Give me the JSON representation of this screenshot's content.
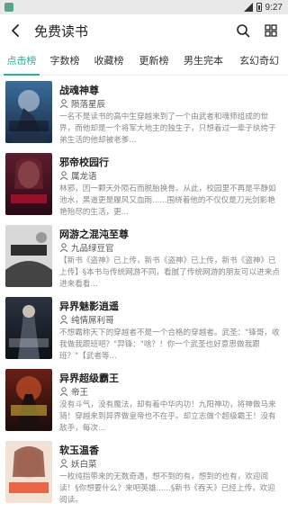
{
  "status_bar": {
    "time": "9:27"
  },
  "header": {
    "title": "免费读书"
  },
  "tabs": [
    {
      "label": "点击榜",
      "active": true
    },
    {
      "label": "字数榜",
      "active": false
    },
    {
      "label": "收藏榜",
      "active": false
    },
    {
      "label": "更新榜",
      "active": false
    },
    {
      "label": "男生完本",
      "active": false
    },
    {
      "label": "玄幻奇幻",
      "active": false
    }
  ],
  "books": [
    {
      "title": "战魂神尊",
      "author": "陨落星辰",
      "desc": "一名不是读书的高中生穿越来到了一个由武者和魂师组成的世界，而他却是一个将军大地主的独生子，只想着过一辈子纨绔子弟生活的他却被老爹..."
    },
    {
      "title": "邪帝校园行",
      "author": "属龙语",
      "desc": "林邪，因一颗天外陨石而脱胎换骨。从此，校园里不再是平静如池水，黑道更是履风又血雨......围绕着他的不仅仅是刀光剑影艳艳殆尽的生活，更..."
    },
    {
      "title": "网游之混沌至尊",
      "author": "九品绿豆官",
      "desc": "【新书《盗神》已上传，新书《盗神》已上传，新书《盗神》已上传】§本书与传统网游不同，看腻了传统网游的朋友可以进来点进来看看..."
    },
    {
      "title": "异界魅影逍遥",
      "author": "纯情屌利哥",
      "desc": "不想霸称天下的穿越者不是一个合格的穿越者。武圣：\"锋哥，收我做我跟班吧？\"羿锋：\"啥？！你一个武圣也好意思做我跟班？\"【武者等..."
    },
    {
      "title": "异界超级霸王",
      "author": "帝王",
      "desc": "没有斗气，没有魔法，却有着中华内功！九阳神功，将神做马来骑！穿越来到异界做皇帝也不在乎。却立志做个超级霸王！没有敌手，每次..."
    },
    {
      "title": "软玉温香",
      "author": "妖白菜",
      "desc": "一枚纯指带来的无数奇遇，想不到的有，想到的也有，欢迎阅读！§你想要什么？来吧英雄......§新书《吞天》已经上传，欢迎阅读。"
    }
  ]
}
